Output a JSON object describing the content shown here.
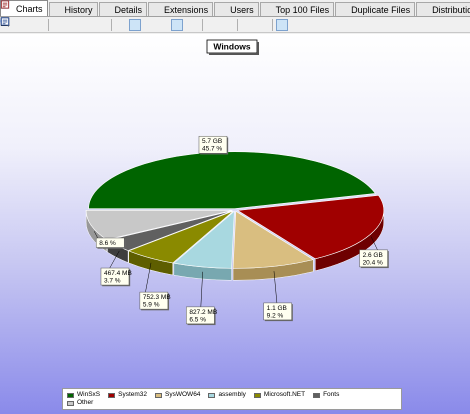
{
  "tabs": [
    {
      "label": "Charts",
      "icon": "pie-chart-icon",
      "color": "#d03030",
      "active": true
    },
    {
      "label": "History",
      "icon": "bar-chart-icon",
      "color": "#c85a20",
      "active": false
    },
    {
      "label": "Details",
      "icon": "details-list-icon",
      "color": "#5a6f8f",
      "active": false
    },
    {
      "label": "Extensions",
      "icon": "extensions-list-icon",
      "color": "#5a6f8f",
      "active": false
    },
    {
      "label": "Users",
      "icon": "users-icon",
      "color": "#4a7fb0",
      "active": false
    },
    {
      "label": "Top 100 Files",
      "icon": "top-files-icon",
      "color": "#4a7fb0",
      "active": false
    },
    {
      "label": "Duplicate Files",
      "icon": "duplicate-files-icon",
      "color": "#7a8fa8",
      "active": false
    },
    {
      "label": "Distributions",
      "icon": "distributions-icon",
      "color": "#a03030",
      "active": false
    }
  ],
  "toolbar": [
    {
      "icon": "refresh-icon",
      "color": "#3a7ac8",
      "pressed": false
    },
    {
      "icon": "export-icon",
      "color": "#d08a20",
      "pressed": false
    },
    {
      "icon": "save-chart-icon",
      "color": "#3a70b8",
      "pressed": false
    },
    {
      "sep": true
    },
    {
      "icon": "copy-icon",
      "color": "#707070",
      "pressed": false
    },
    {
      "icon": "email-icon",
      "color": "#707070",
      "pressed": false
    },
    {
      "icon": "print-icon",
      "color": "#606060",
      "pressed": false
    },
    {
      "icon": "save-icon",
      "color": "#2a4f9a",
      "pressed": false
    },
    {
      "sep": true
    },
    {
      "icon": "chart-view-icon",
      "color": "#8a8a30",
      "pressed": false
    },
    {
      "icon": "list-view-icon",
      "color": "#3a5a9a",
      "pressed": true
    },
    {
      "icon": "grid-view-icon",
      "color": "#606060",
      "pressed": false
    },
    {
      "icon": "details-view-icon",
      "color": "#606060",
      "pressed": false
    },
    {
      "icon": "area-chart-icon",
      "color": "#3a60c8",
      "pressed": true
    },
    {
      "icon": "bar-chart-toggle-icon",
      "color": "#c85a20",
      "pressed": false
    },
    {
      "sep": true
    },
    {
      "icon": "color-picker-icon",
      "color": "#000000",
      "pressed": false
    },
    {
      "icon": "chevron-down-icon",
      "color": "#000000",
      "pressed": false
    },
    {
      "sep": true
    },
    {
      "icon": "zoom-in-icon",
      "color": "#3a6ab8",
      "pressed": false
    },
    {
      "icon": "zoom-out-icon",
      "color": "#3a6ab8",
      "pressed": false
    },
    {
      "sep": true
    },
    {
      "icon": "layout-icon",
      "color": "#3a5a9a",
      "pressed": true
    },
    {
      "icon": "legend-icon",
      "color": "#3a5a9a",
      "pressed": false
    },
    {
      "icon": "labels-icon",
      "color": "#3a5a9a",
      "pressed": false
    }
  ],
  "chart": {
    "title": "Windows",
    "slices": [
      {
        "name": "WinSxS",
        "size": "5.7 GB",
        "percent": 45.7,
        "percent_label": "45.7 %",
        "color": "#006400",
        "side": "#004a00"
      },
      {
        "name": "System32",
        "size": "2.6 GB",
        "percent": 20.4,
        "percent_label": "20.4 %",
        "color": "#a00000",
        "side": "#6e0000"
      },
      {
        "name": "SysWOW64",
        "size": "1.1 GB",
        "percent": 9.2,
        "percent_label": "9.2 %",
        "color": "#d9be80",
        "side": "#a88e55"
      },
      {
        "name": "assembly",
        "size": "827.2 MB",
        "percent": 6.5,
        "percent_label": "6.5 %",
        "color": "#a8d8e0",
        "side": "#78a8b0"
      },
      {
        "name": "Microsoft.NET",
        "size": "752.3 MB",
        "percent": 5.9,
        "percent_label": "5.9 %",
        "color": "#8a8a00",
        "side": "#5e5e00"
      },
      {
        "name": "Fonts",
        "size": "467.4 MB",
        "percent": 3.7,
        "percent_label": "3.7 %",
        "color": "#606060",
        "side": "#3e3e3e"
      },
      {
        "name": "Other",
        "size": "",
        "percent": 8.6,
        "percent_label": "8.6 %",
        "color": "#c8c8c8",
        "side": "#989898"
      }
    ]
  }
}
